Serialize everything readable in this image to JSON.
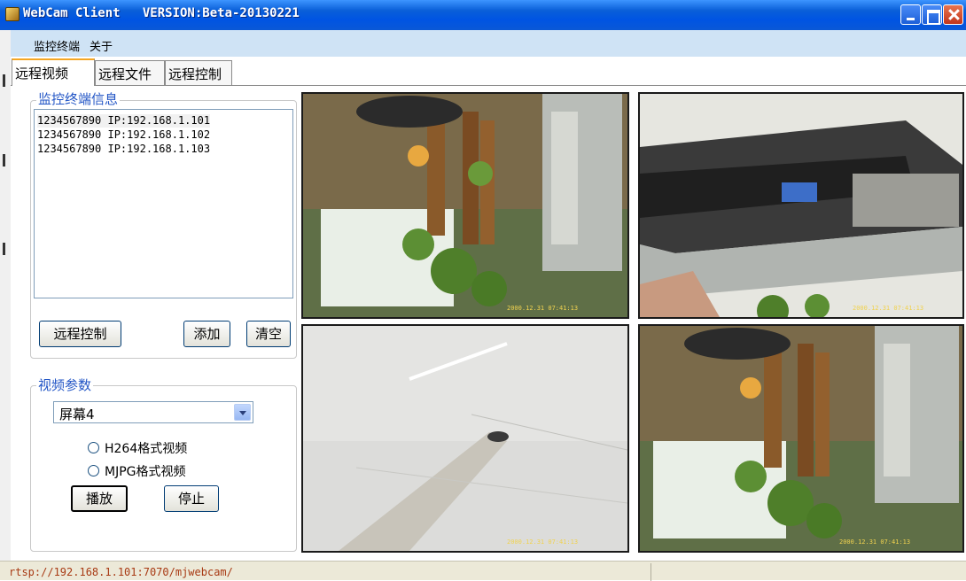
{
  "window": {
    "title": "WebCam Client   VERSION:Beta-20130221"
  },
  "menubar": {
    "items": [
      "监控终端",
      "关于"
    ]
  },
  "tabs": [
    {
      "label": "远程视频",
      "active": true
    },
    {
      "label": "远程文件",
      "active": false
    },
    {
      "label": "远程控制",
      "active": false
    }
  ],
  "terminal_info": {
    "legend": "监控终端信息",
    "items": [
      "1234567890 IP:192.168.1.101",
      "1234567890 IP:192.168.1.102",
      "1234567890 IP:192.168.1.103"
    ],
    "buttons": {
      "remote": "远程控制",
      "add": "添加",
      "clear": "清空"
    }
  },
  "video_params": {
    "legend": "视频参数",
    "screen_select": "屏幕4",
    "formats": [
      "H264格式视频",
      "MJPG格式视频"
    ],
    "buttons": {
      "play": "播放",
      "stop": "停止"
    }
  },
  "status": {
    "url": "rtsp://192.168.1.101:7070/mjwebcam/"
  },
  "colors": {
    "titlebar": "#0054e3",
    "menubar": "#cfe3f5",
    "legend": "#2356c6",
    "status_text": "#a83a14",
    "active_tab_accent": "#f5a623"
  }
}
